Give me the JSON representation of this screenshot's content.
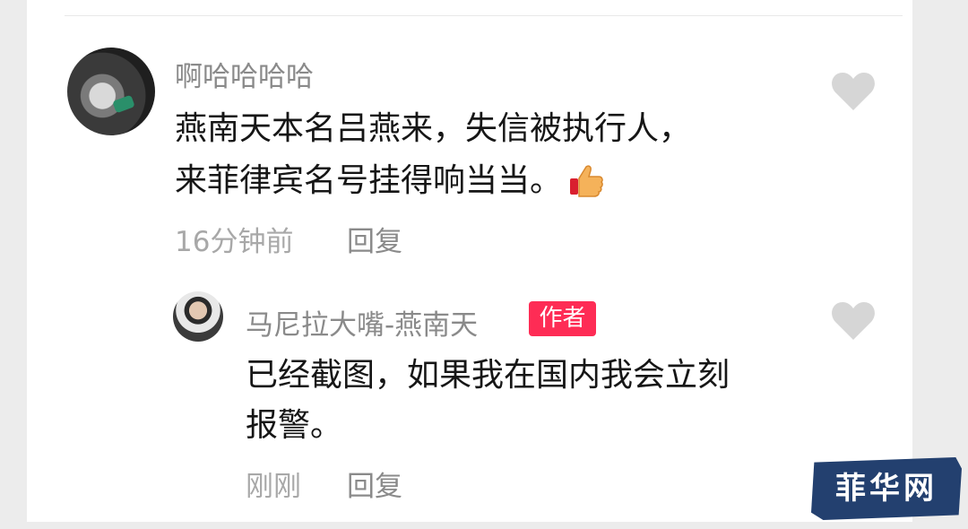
{
  "comments": [
    {
      "username": "啊哈哈哈哈",
      "lines": [
        "燕南天本名吕燕来，失信被执行人，",
        "来菲律宾名号挂得响当当。"
      ],
      "emoji": "thumbs-up-icon",
      "time": "16分钟前",
      "reply_label": "回复"
    },
    {
      "username": "马尼拉大嘴-燕南天",
      "badge": "作者",
      "lines": [
        "已经截图，如果我在国内我会立刻",
        "报警。"
      ],
      "time": "刚刚",
      "reply_label": "回复"
    }
  ],
  "watermark": "菲华网",
  "colors": {
    "badge": "#fe2c55",
    "text": "#161616",
    "meta": "#a8a8a8",
    "username": "#8a8a8a",
    "watermark_bg": "#23406f"
  }
}
